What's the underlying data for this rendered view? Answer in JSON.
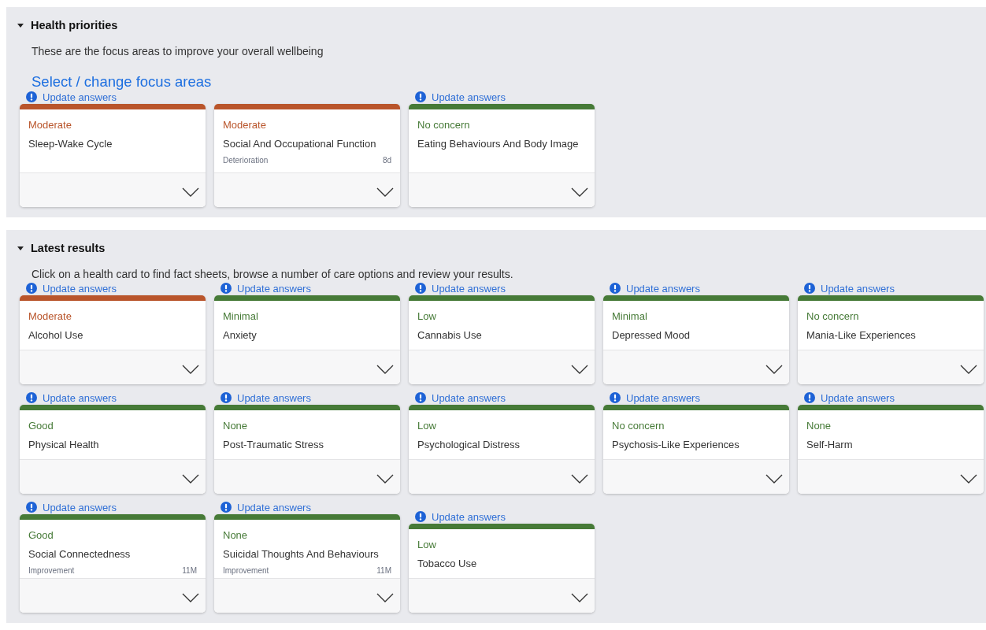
{
  "sections": [
    {
      "title": "Health priorities",
      "expanded": true,
      "description": "These are the focus areas to improve your overall wellbeing",
      "link": "Select / change focus areas",
      "cards": [
        {
          "update": "Update answers",
          "color": "#b9552b",
          "status": "Moderate",
          "title": "Sleep-Wake Cycle"
        },
        {
          "color": "#b9552b",
          "status": "Moderate",
          "title": "Social And Occupational Function",
          "trend": {
            "label": "Deterioration",
            "time": "8d"
          }
        },
        {
          "update": "Update answers",
          "color": "#467a37",
          "status": "No concern",
          "title": "Eating Behaviours And Body Image"
        }
      ]
    },
    {
      "title": "Latest results",
      "expanded": true,
      "description": "Click on a health card to find fact sheets, browse a number of care options and review your results.",
      "cards": [
        {
          "update": "Update answers",
          "color": "#b9552b",
          "status": "Moderate",
          "title": "Alcohol Use"
        },
        {
          "update": "Update answers",
          "color": "#467a37",
          "status": "Minimal",
          "title": "Anxiety"
        },
        {
          "update": "Update answers",
          "color": "#467a37",
          "status": "Low",
          "title": "Cannabis Use"
        },
        {
          "update": "Update answers",
          "color": "#467a37",
          "status": "Minimal",
          "title": "Depressed Mood"
        },
        {
          "update": "Update answers",
          "color": "#467a37",
          "status": "No concern",
          "title": "Mania-Like Experiences"
        },
        {
          "update": "Update answers",
          "color": "#467a37",
          "status": "Good",
          "title": "Physical Health"
        },
        {
          "update": "Update answers",
          "color": "#467a37",
          "status": "None",
          "title": "Post-Traumatic Stress"
        },
        {
          "update": "Update answers",
          "color": "#467a37",
          "status": "Low",
          "title": "Psychological Distress"
        },
        {
          "update": "Update answers",
          "color": "#467a37",
          "status": "No concern",
          "title": "Psychosis-Like Experiences"
        },
        {
          "update": "Update answers",
          "color": "#467a37",
          "status": "None",
          "title": "Self-Harm"
        },
        {
          "update": "Update answers",
          "color": "#467a37",
          "status": "Good",
          "title": "Social Connectedness",
          "trend": {
            "label": "Improvement",
            "time": "11M"
          }
        },
        {
          "update": "Update answers",
          "color": "#467a37",
          "status": "None",
          "title": "Suicidal Thoughts And Behaviours",
          "trend": {
            "label": "Improvement",
            "time": "11M"
          }
        },
        {
          "update": "Update answers",
          "color": "#467a37",
          "status": "Low",
          "title": "Tobacco Use"
        }
      ]
    }
  ]
}
